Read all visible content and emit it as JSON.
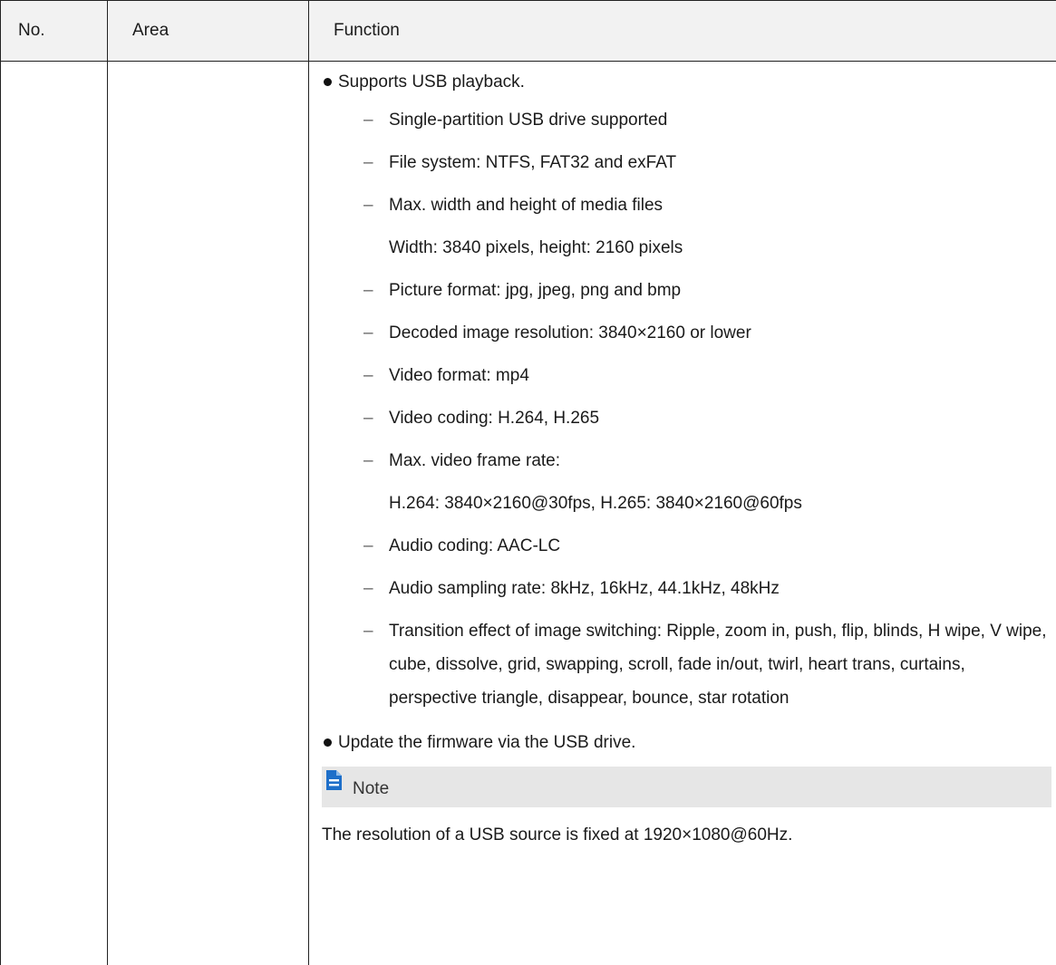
{
  "headers": {
    "no": "No.",
    "area": "Area",
    "function": "Function"
  },
  "bullets": [
    "Supports USB playback.",
    "Update the firmware via the USB drive."
  ],
  "sub_items": [
    {
      "text": "Single-partition USB drive supported"
    },
    {
      "text": "File system: NTFS, FAT32 and exFAT"
    },
    {
      "text": "Max. width and height of media files",
      "cont": "Width: 3840 pixels, height: 2160 pixels"
    },
    {
      "text": "Picture format: jpg, jpeg, png and bmp"
    },
    {
      "text": "Decoded image resolution: 3840×2160 or lower"
    },
    {
      "text": "Video format: mp4"
    },
    {
      "text": "Video coding: H.264, H.265"
    },
    {
      "text": "Max. video frame rate:",
      "cont": "H.264: 3840×2160@30fps, H.265: 3840×2160@60fps"
    },
    {
      "text": "Audio coding: AAC-LC"
    },
    {
      "text": "Audio sampling rate: 8kHz, 16kHz, 44.1kHz, 48kHz"
    },
    {
      "text": "Transition effect of image switching: Ripple, zoom in, push, flip, blinds, H wipe, V wipe, cube, dissolve, grid, swapping, scroll, fade in/out, twirl, heart trans, curtains, perspective triangle, disappear, bounce, star rotation"
    }
  ],
  "dash_glyph": "–",
  "note": {
    "label": "Note",
    "text": "The resolution of a USB source is fixed at 1920×1080@60Hz.",
    "icon": "document-note-icon",
    "icon_color": "#1e6fc9"
  },
  "colors": {
    "header_bg": "#f2f2f2",
    "note_bg": "#e6e6e6",
    "border": "#222222"
  }
}
